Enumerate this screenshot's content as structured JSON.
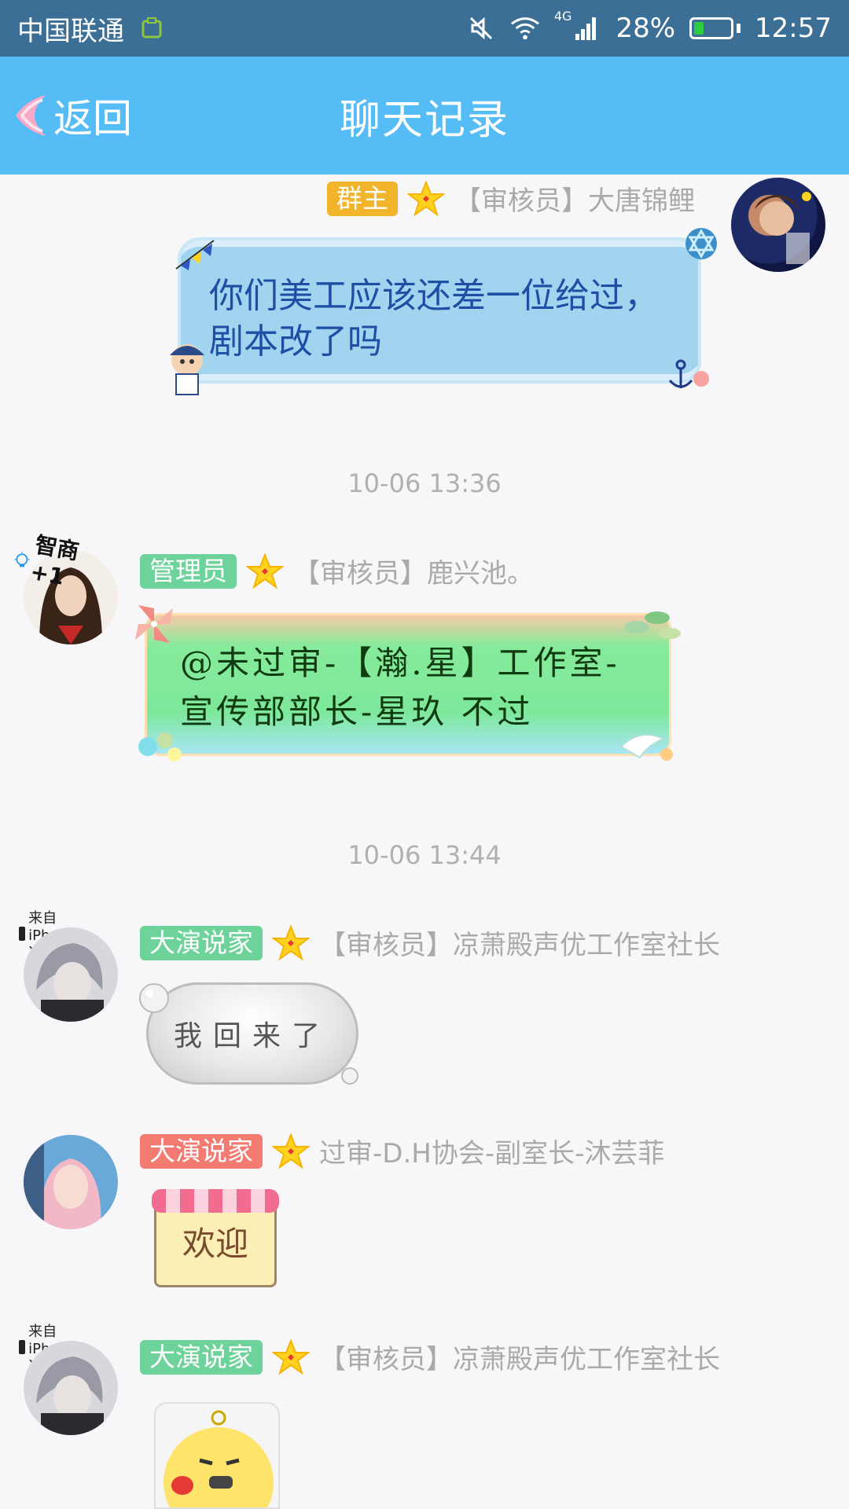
{
  "status_bar": {
    "carrier": "中国联通",
    "network": "4G",
    "battery": "28%",
    "time": "12:57",
    "battery_level": 0.28
  },
  "header": {
    "back_label": "返回",
    "title": "聊天记录"
  },
  "messages": [
    {
      "badge": "群主",
      "badge_color": "#f1b42a",
      "sender": "【审核员】大唐锦鲤",
      "text": "你们美工应该还差一位给过，剧本改了吗",
      "side": "right"
    },
    {
      "timestamp": "10-06 13:36",
      "badge": "管理员",
      "badge_color": "#6dd39a",
      "sender": "【审核员】鹿兴池。",
      "avatar_tag": "智商+1",
      "text": "@未过审-【瀚.星】工作室-宣传部部长-星玖 不过",
      "side": "left"
    },
    {
      "timestamp": "10-06 13:44",
      "device": "来自iPhone X",
      "badge": "大演说家",
      "badge_color": "#6dd39a",
      "sender": "【审核员】凉萧殿声优工作室社长",
      "text": "我回来了",
      "side": "left"
    },
    {
      "badge": "大演说家",
      "badge_color": "#f37b72",
      "sender": "过审-D.H协会-副室长-沐芸菲",
      "sticker_text": "欢迎",
      "side": "left"
    },
    {
      "device": "来自iPhone X",
      "badge": "大演说家",
      "badge_color": "#6dd39a",
      "sender": "【审核员】凉萧殿声优工作室社长",
      "side": "left"
    }
  ]
}
